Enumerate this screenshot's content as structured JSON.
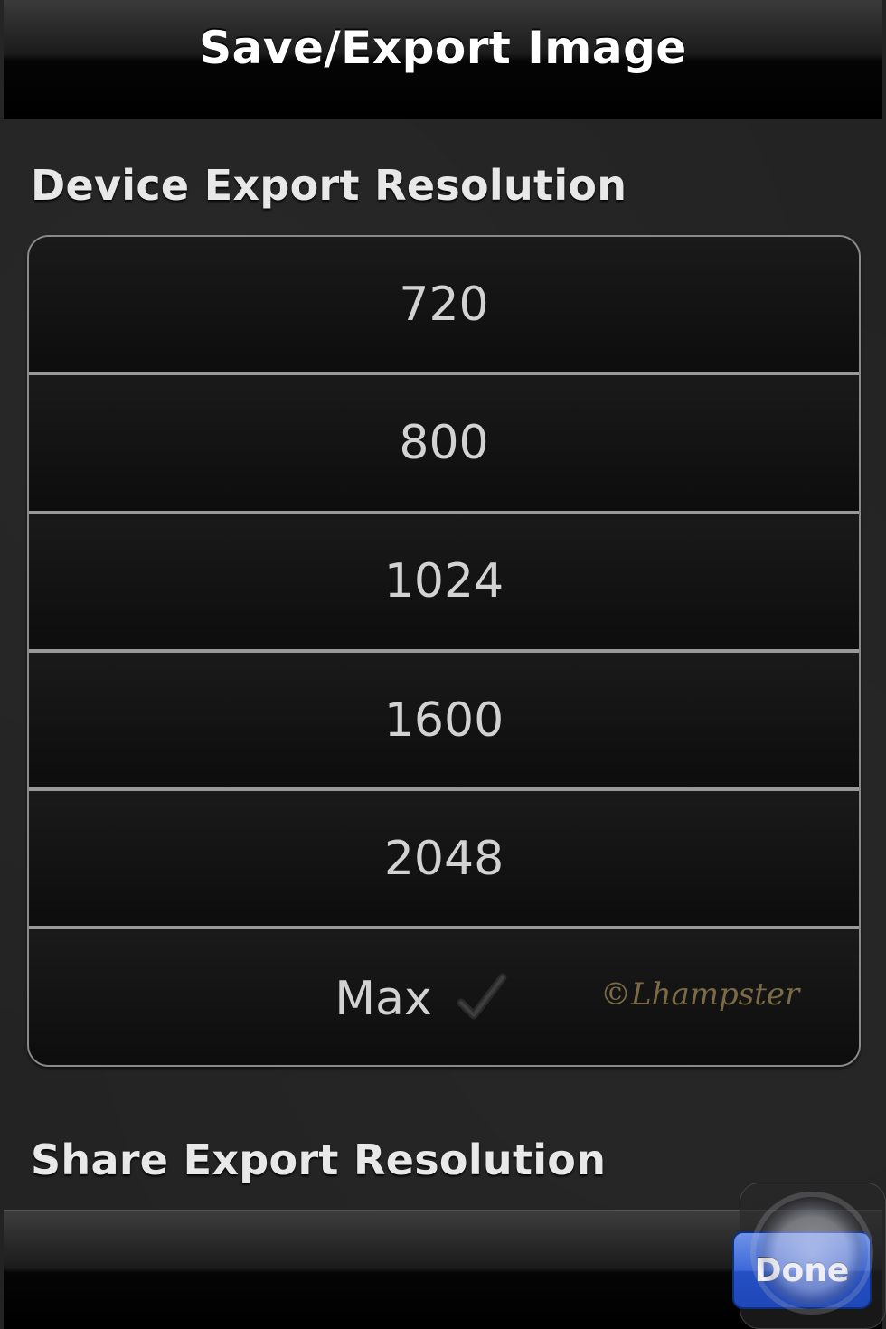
{
  "header": {
    "title": "Save/Export Image"
  },
  "device_section": {
    "title": "Device Export Resolution",
    "options": [
      {
        "label": "720",
        "selected": false
      },
      {
        "label": "800",
        "selected": false
      },
      {
        "label": "1024",
        "selected": false
      },
      {
        "label": "1600",
        "selected": false
      },
      {
        "label": "2048",
        "selected": false
      },
      {
        "label": "Max",
        "selected": true
      }
    ]
  },
  "watermark": "©Lhampster",
  "share_section": {
    "title": "Share Export Resolution"
  },
  "toolbar": {
    "done_label": "Done"
  },
  "colors": {
    "accent": "#3d68d8",
    "text": "#d2d2d2",
    "background": "#232323"
  }
}
